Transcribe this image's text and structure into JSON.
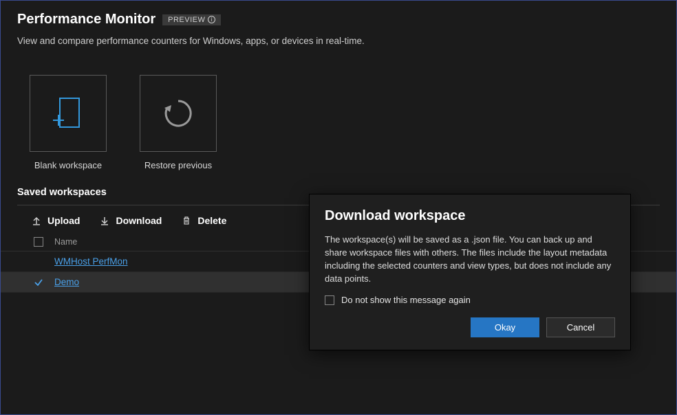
{
  "header": {
    "title": "Performance Monitor",
    "badge": "PREVIEW",
    "subtitle": "View and compare performance counters for Windows, apps, or devices in real-time."
  },
  "tiles": {
    "blank": "Blank workspace",
    "restore": "Restore previous"
  },
  "saved": {
    "heading": "Saved workspaces",
    "toolbar": {
      "upload": "Upload",
      "download": "Download",
      "delete": "Delete"
    },
    "columns": {
      "name": "Name"
    },
    "rows": [
      {
        "name": "WMHost PerfMon",
        "selected": false
      },
      {
        "name": "Demo",
        "selected": true
      }
    ]
  },
  "dialog": {
    "title": "Download workspace",
    "body": "The workspace(s) will be saved as a .json file. You can back up and share workspace files with others. The files include the layout metadata including the selected counters and view types, but does not include any data points.",
    "checkbox_label": "Do not show this message again",
    "ok": "Okay",
    "cancel": "Cancel"
  }
}
